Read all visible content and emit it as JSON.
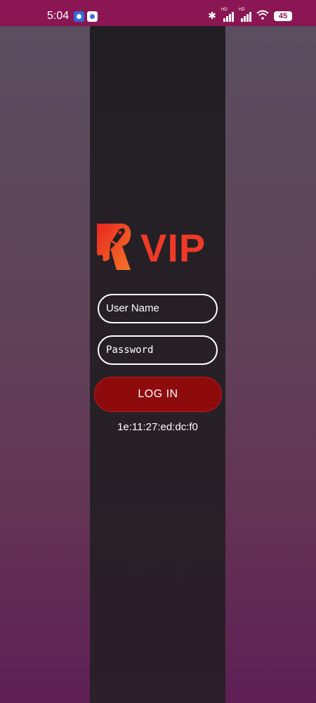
{
  "status_bar": {
    "time": "5:04",
    "battery": "45",
    "hd_label": "HD",
    "icons": [
      "bluetooth-icon",
      "signal-icon",
      "signal-icon",
      "wifi-icon",
      "battery-icon"
    ]
  },
  "logo": {
    "text": "VIP",
    "icon": "rocket-r-icon",
    "colors": {
      "primary": "#ee3a26",
      "secondary": "#f5752b"
    }
  },
  "form": {
    "username_placeholder": "User Name",
    "password_placeholder": "Password",
    "login_label": "LOG IN"
  },
  "device_id": "1e:11:27:ed:dc:f0",
  "colors": {
    "status_bar": "#8a1653",
    "panel": "#241f25",
    "login_button": "#8e0b0d"
  }
}
